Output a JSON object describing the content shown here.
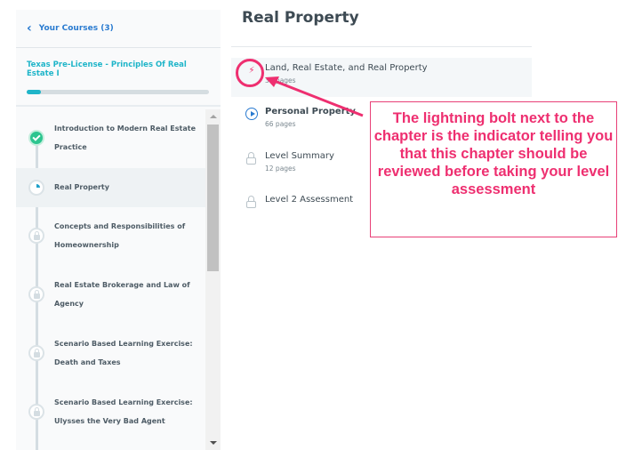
{
  "sidebar": {
    "back_label": "Your Courses (3)",
    "course_title": "Texas Pre-License - Principles Of Real Estate I",
    "progress_fraction": 0.08,
    "chapters": [
      {
        "label": "Introduction to Modern Real Estate Practice",
        "status": "completed"
      },
      {
        "label": "Real Property",
        "status": "in-progress"
      },
      {
        "label": "Concepts and Responsibilities of Homeownership",
        "status": "locked"
      },
      {
        "label": "Real Estate Brokerage and Law of Agency",
        "status": "locked"
      },
      {
        "label": "Scenario Based Learning Exercise: Death and Taxes",
        "status": "locked"
      },
      {
        "label": "Scenario Based Learning Exercise: Ulysses the Very Bad Agent",
        "status": "locked"
      }
    ]
  },
  "main": {
    "title": "Real Property",
    "lessons": [
      {
        "title": "Land, Real Estate, and Real Property",
        "pages": "36 pages",
        "icon": "lightning-bolt-icon"
      },
      {
        "title": "Personal Property",
        "pages": "66 pages",
        "icon": "play-icon"
      },
      {
        "title": "Level Summary",
        "pages": "12 pages",
        "icon": "lock-icon"
      },
      {
        "title": "Level 2 Assessment",
        "pages": "",
        "icon": "lock-icon"
      }
    ]
  },
  "annotation": {
    "text": "The lightning bolt next to the chapter is the indicator telling you that this chapter should be reviewed before taking your level assessment",
    "color": "#ee2f70"
  },
  "colors": {
    "accent_blue": "#2a7bd0",
    "accent_teal": "#1fb5c9",
    "complete_green": "#2cc58f"
  }
}
